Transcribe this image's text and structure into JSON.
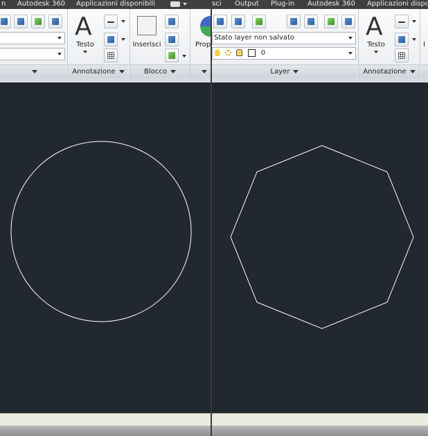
{
  "left": {
    "menu": {
      "item_1": "n",
      "item_2": "Autodesk 360",
      "item_3": "Applicazioni disponibili"
    },
    "panels": {
      "annotation_title": "Annotazione",
      "block_title": "Blocco"
    },
    "buttons": {
      "text_label": "Testo",
      "insert_label": "Inserisci",
      "properties_label": "Prop"
    }
  },
  "right": {
    "menu": {
      "item_1": "sci",
      "item_2": "Output",
      "item_3": "Plug-in",
      "item_4": "Autodesk 360",
      "item_5": "Applicazioni disponi"
    },
    "layer": {
      "state_value": "Stato layer non salvato",
      "current_layer": "0",
      "panel_title": "Layer"
    },
    "panels": {
      "annotation_title": "Annotazione"
    },
    "buttons": {
      "text_label": "Testo",
      "truncated_label": "I"
    }
  },
  "colors": {
    "canvas_background": "#212830",
    "geometry_stroke": "#ffffff",
    "menubar": "#3f3f3f"
  },
  "icons": [
    "layer-icon",
    "match-layer-icon",
    "text-icon",
    "dimension-icon",
    "leader-icon",
    "table-icon",
    "insert-block-icon",
    "create-block-icon",
    "edit-block-icon",
    "properties-wheel-icon",
    "lightbulb-icon",
    "sun-icon",
    "lock-icon",
    "color-swatch-icon"
  ],
  "drawings": {
    "left_shape": "circle",
    "right_shape": "octagon"
  }
}
